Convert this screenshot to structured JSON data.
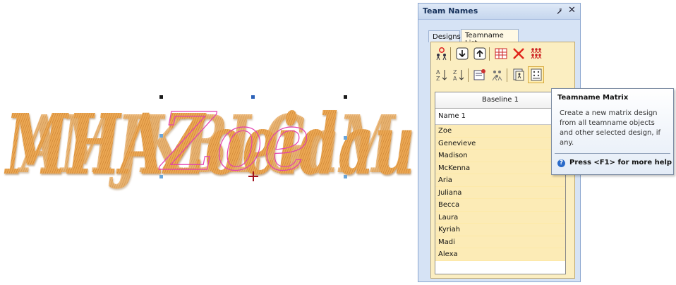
{
  "canvas": {
    "embroidered_text": "Zoe"
  },
  "panel": {
    "title": "Team Names",
    "pin_glyph": "⭷",
    "close_glyph": "✕",
    "tabs": [
      {
        "label": "Designs",
        "active": false
      },
      {
        "label": "Teamname List",
        "active": true
      }
    ],
    "toolbar_row1": [
      "add-name-icon",
      "move-down-icon",
      "move-up-icon",
      "numbers-icon",
      "delete-icon",
      "multi-people-icon"
    ],
    "toolbar_row2": [
      "sort-az-icon",
      "sort-za-icon",
      "properties-icon",
      "team-icon",
      "single-design-icon",
      "matrix-design-icon"
    ],
    "list": {
      "baseline_header": "Baseline 1",
      "name_header": "Name 1",
      "names": [
        "Zoe",
        "Genevieve",
        "Madison",
        "McKenna",
        "Aria",
        "Juliana",
        "Becca",
        "Laura",
        "Kyriah",
        "Madi",
        "Alexa"
      ]
    }
  },
  "tooltip": {
    "title": "Teamname Matrix",
    "body": "Create a new matrix design from all teamname objects and other selected design, if any.",
    "help_text": "Press <F1> for more help"
  },
  "colors": {
    "thread": "#e9a756",
    "thread_dark": "#b36a22",
    "outline": "#e33fb0",
    "panel": "#d6e3f5",
    "tab_body": "#fbeec1",
    "row_highlight": "#fcebb6"
  }
}
